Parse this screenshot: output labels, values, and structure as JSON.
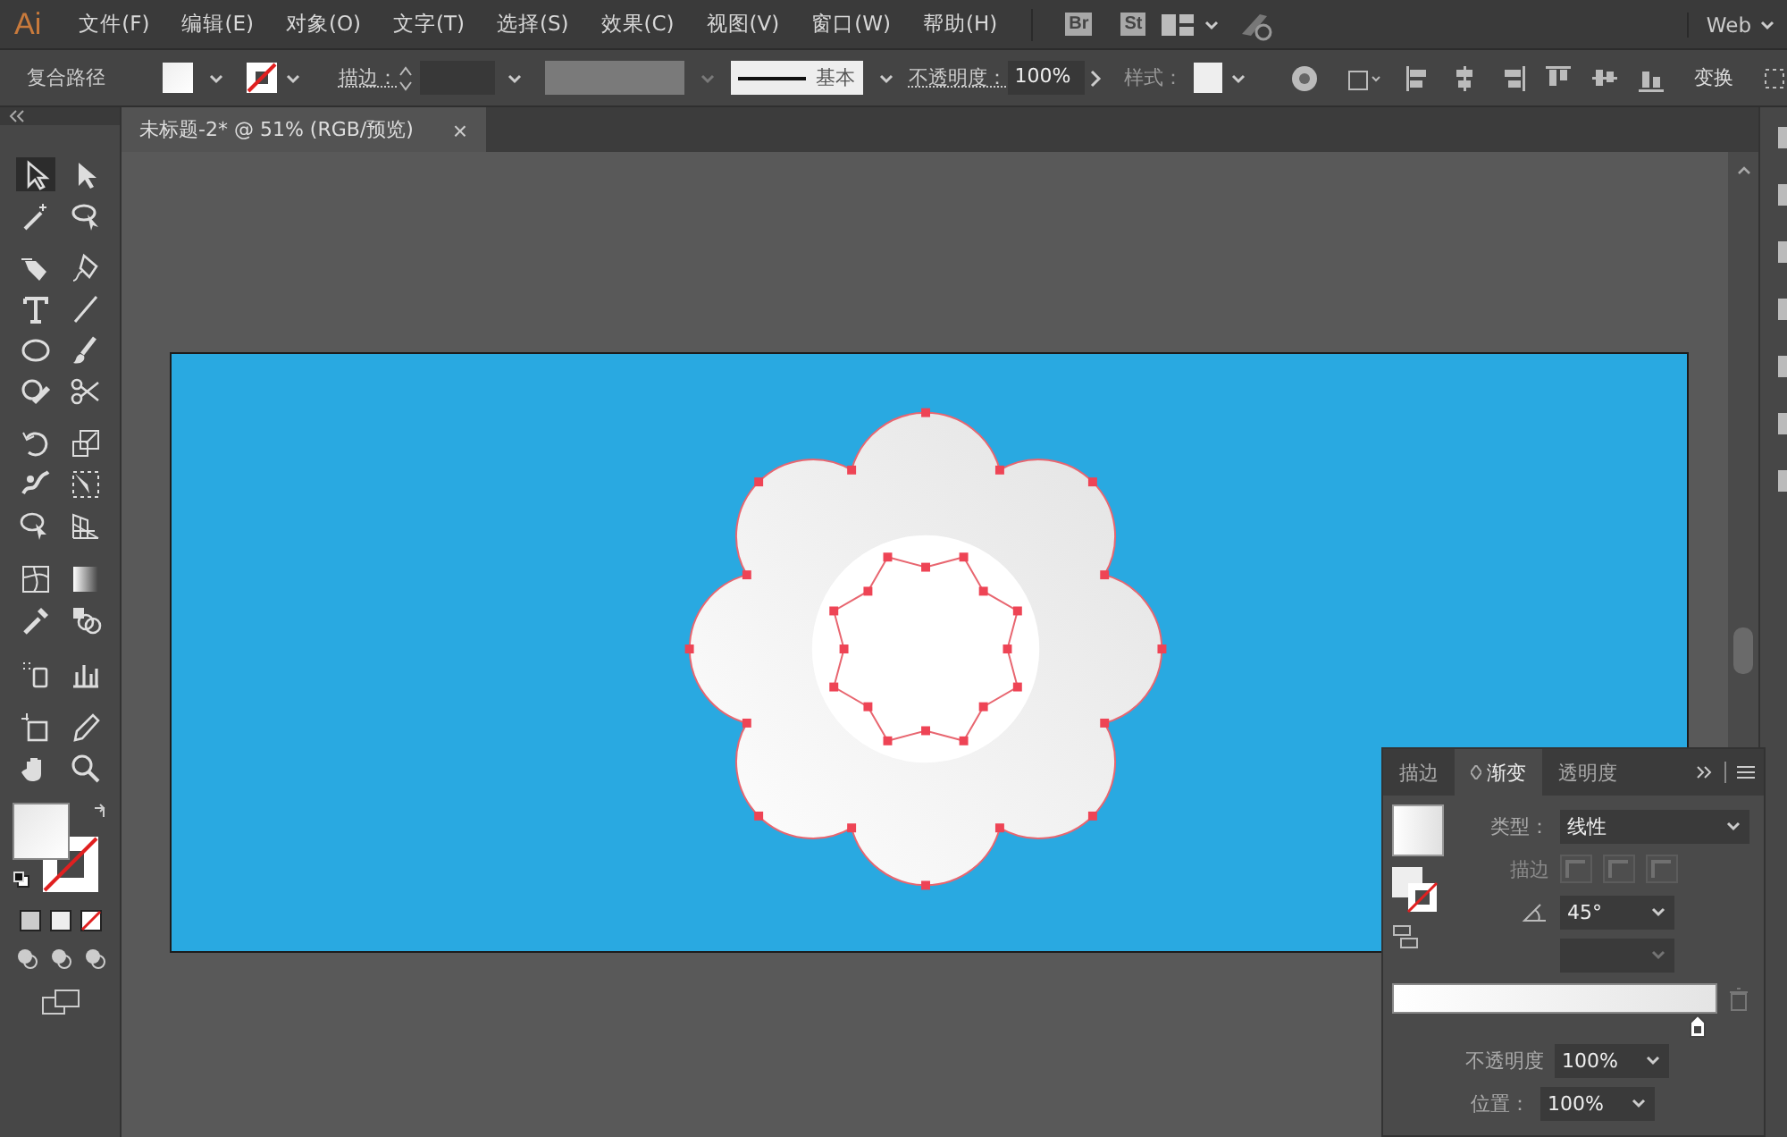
{
  "app": {
    "logo": "Ai",
    "workspace": "Web"
  },
  "menu": [
    "文件(F)",
    "编辑(E)",
    "对象(O)",
    "文字(T)",
    "选择(S)",
    "效果(C)",
    "视图(V)",
    "窗口(W)",
    "帮助(H)"
  ],
  "app_badges": [
    "Br",
    "St"
  ],
  "control_bar": {
    "selection": "复合路径",
    "stroke_label": "描边：",
    "stroke_style": "基本",
    "opacity_label": "不透明度：",
    "opacity": "100%",
    "style_label": "样式：",
    "transform": "变换"
  },
  "document_tab": {
    "title": "未标题-2* @ 51% (RGB/预览)",
    "close": "×"
  },
  "gradient_panel": {
    "tabs": [
      {
        "label": "描边",
        "selected": false
      },
      {
        "label": "渐变",
        "selected": true
      },
      {
        "label": "透明度",
        "selected": false
      }
    ],
    "type_label": "类型：",
    "type": "线性",
    "stroke_row": {
      "label": "描边",
      "disabled": true
    },
    "angle": "45°",
    "opacity_label": "不透明度",
    "opacity": "100%",
    "location_label": "位置：",
    "location": "100%"
  }
}
